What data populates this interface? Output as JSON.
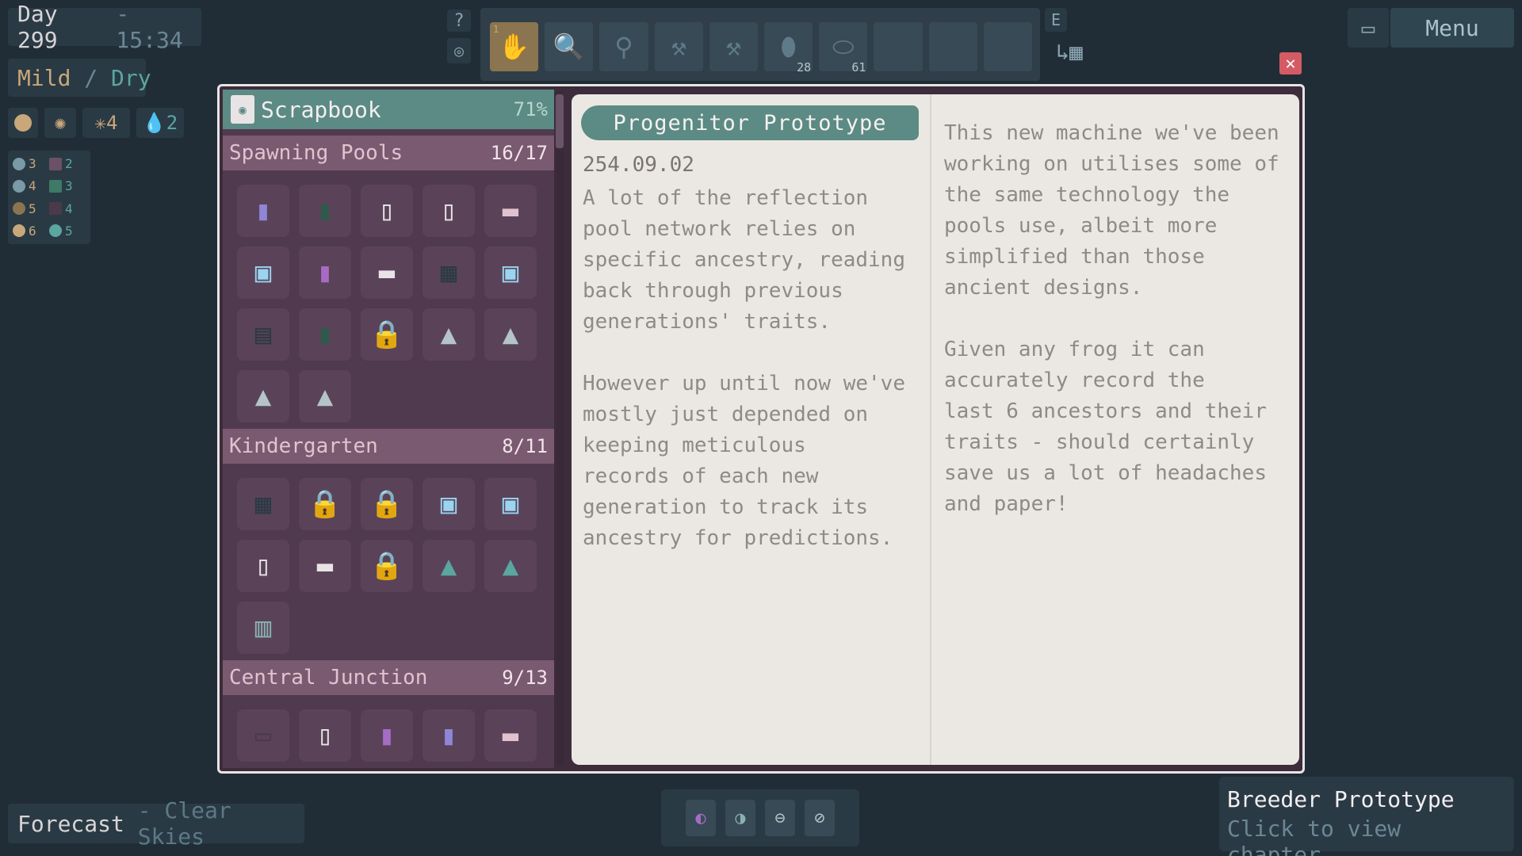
{
  "hud": {
    "day_label": "Day 299",
    "time": "- 15:34",
    "weather_temp": "Mild",
    "weather_sep": "/",
    "weather_humidity": "Dry",
    "stats": [
      {
        "icon": "sun-orb-icon",
        "value": ""
      },
      {
        "icon": "sun-icon",
        "value": ""
      },
      {
        "icon": "spark-icon",
        "value": "4"
      },
      {
        "icon": "water-drop-icon",
        "value": "2"
      }
    ],
    "grid_stats": [
      "3",
      "2",
      "4",
      "3",
      "5",
      "4",
      "6",
      "5"
    ],
    "forecast_label": "Forecast",
    "forecast_value": "- Clear Skies",
    "help": "?",
    "e_key": "E",
    "menu": "Menu"
  },
  "toolbar": {
    "slots": [
      {
        "num": "1",
        "icon": "hand-icon",
        "glyph": "✋",
        "count": "",
        "active": true
      },
      {
        "num": "",
        "icon": "magnifier-icon",
        "glyph": "🔍",
        "count": ""
      },
      {
        "num": "",
        "icon": "net-icon",
        "glyph": "⚲",
        "count": ""
      },
      {
        "num": "",
        "icon": "shovel-icon",
        "glyph": "⚒",
        "count": ""
      },
      {
        "num": "",
        "icon": "shovel-icon",
        "glyph": "⚒",
        "count": ""
      },
      {
        "num": "",
        "icon": "seed-icon",
        "glyph": "⬮",
        "count": "28"
      },
      {
        "num": "",
        "icon": "pill-icon",
        "glyph": "⬭",
        "count": "61"
      },
      {
        "num": "",
        "icon": "empty-slot-icon",
        "glyph": "",
        "count": ""
      },
      {
        "num": "",
        "icon": "empty-slot-icon",
        "glyph": "",
        "count": ""
      },
      {
        "num": "",
        "icon": "empty-slot-icon",
        "glyph": "",
        "count": ""
      }
    ]
  },
  "scrapbook": {
    "title": "Scrapbook",
    "percent": "71%",
    "sections": [
      {
        "name": "Spawning Pools",
        "count": "16/17",
        "items": [
          {
            "icon": "book-icon",
            "glyph": "▮",
            "color": "#8e86d8",
            "locked": false
          },
          {
            "icon": "book-icon",
            "glyph": "▮",
            "color": "#2e5a4e",
            "locked": false
          },
          {
            "icon": "note-icon",
            "glyph": "▯",
            "color": "#e8e4e6",
            "locked": false
          },
          {
            "icon": "note-icon",
            "glyph": "▯",
            "color": "#e8e4e6",
            "locked": false
          },
          {
            "icon": "sign-icon",
            "glyph": "▬",
            "color": "#e2c2cf",
            "locked": false
          },
          {
            "icon": "machine-icon",
            "glyph": "▣",
            "color": "#9ad4f0",
            "locked": false
          },
          {
            "icon": "book-icon",
            "glyph": "▮",
            "color": "#a66cc4",
            "locked": false
          },
          {
            "icon": "sign-icon",
            "glyph": "▬",
            "color": "#e8e4e6",
            "locked": false
          },
          {
            "icon": "panel-icon",
            "glyph": "▦",
            "color": "#2a3a44",
            "locked": false
          },
          {
            "icon": "machine-icon",
            "glyph": "▣",
            "color": "#9ad4f0",
            "locked": false
          },
          {
            "icon": "document-icon",
            "glyph": "▤",
            "color": "#2a3a44",
            "locked": false
          },
          {
            "icon": "book-icon",
            "glyph": "▮",
            "color": "#2e5a4e",
            "locked": false
          },
          {
            "icon": "lock-icon",
            "glyph": "🔒",
            "color": "#6b5168",
            "locked": true
          },
          {
            "icon": "frog-statue-icon",
            "glyph": "▲",
            "color": "#b4c4c8",
            "locked": false
          },
          {
            "icon": "frog-statue-icon",
            "glyph": "▲",
            "color": "#b4c4c8",
            "locked": false
          },
          {
            "icon": "frog-statue-icon",
            "glyph": "▲",
            "color": "#b4c4c8",
            "locked": false
          },
          {
            "icon": "frog-statue-icon",
            "glyph": "▲",
            "color": "#b4c4c8",
            "locked": false
          }
        ]
      },
      {
        "name": "Kindergarten",
        "count": "8/11",
        "items": [
          {
            "icon": "panel-icon",
            "glyph": "▦",
            "color": "#2a3a44",
            "locked": false
          },
          {
            "icon": "lock-icon",
            "glyph": "🔒",
            "color": "#6b5168",
            "locked": true
          },
          {
            "icon": "lock-icon",
            "glyph": "🔒",
            "color": "#6b5168",
            "locked": true
          },
          {
            "icon": "machine-icon",
            "glyph": "▣",
            "color": "#9ad4f0",
            "locked": false
          },
          {
            "icon": "machine-icon",
            "glyph": "▣",
            "color": "#9ad4f0",
            "locked": false
          },
          {
            "icon": "note-icon",
            "glyph": "▯",
            "color": "#e8e4e6",
            "locked": false
          },
          {
            "icon": "sign-icon",
            "glyph": "▬",
            "color": "#e8e4e6",
            "locked": false
          },
          {
            "icon": "lock-icon",
            "glyph": "🔒",
            "color": "#6b5168",
            "locked": true
          },
          {
            "icon": "frog-statue-icon",
            "glyph": "▲",
            "color": "#5aa6a0",
            "locked": false
          },
          {
            "icon": "frog-statue-icon",
            "glyph": "▲",
            "color": "#5aa6a0",
            "locked": false
          },
          {
            "icon": "crate-icon",
            "glyph": "▥",
            "color": "#8ab0b0",
            "locked": false
          }
        ]
      },
      {
        "name": "Central Junction",
        "count": "9/13",
        "items": [
          {
            "icon": "jar-icon",
            "glyph": "▭",
            "color": "#4a3a4a",
            "locked": false
          },
          {
            "icon": "note-icon",
            "glyph": "▯",
            "color": "#e8e4e6",
            "locked": false
          },
          {
            "icon": "book-icon",
            "glyph": "▮",
            "color": "#a66cc4",
            "locked": false
          },
          {
            "icon": "book-icon",
            "glyph": "▮",
            "color": "#8e86d8",
            "locked": false
          },
          {
            "icon": "sign-icon",
            "glyph": "▬",
            "color": "#e2c2cf",
            "locked": false
          }
        ]
      }
    ]
  },
  "entry": {
    "title": "Progenitor Prototype",
    "date": "254.09.02",
    "left_text": "A lot of the reflection\npool network relies on\nspecific ancestry, reading\nback through previous\ngenerations' traits.\n\nHowever up until now we've\nmostly just depended on\nkeeping meticulous\nrecords of each new\ngeneration to track its\nancestry for predictions.",
    "right_text": "This new machine we've been\nworking on utilises some of\nthe same technology the\npools use, albeit more\nsimplified than those\nancient designs.\n\nGiven any frog it can\naccurately record the\nlast 6 ancestors and their\ntraits - should certainly\nsave us a lot of headaches\nand paper!"
  },
  "tooltip": {
    "title": "Breeder Prototype",
    "action": "Click to view chapter"
  }
}
